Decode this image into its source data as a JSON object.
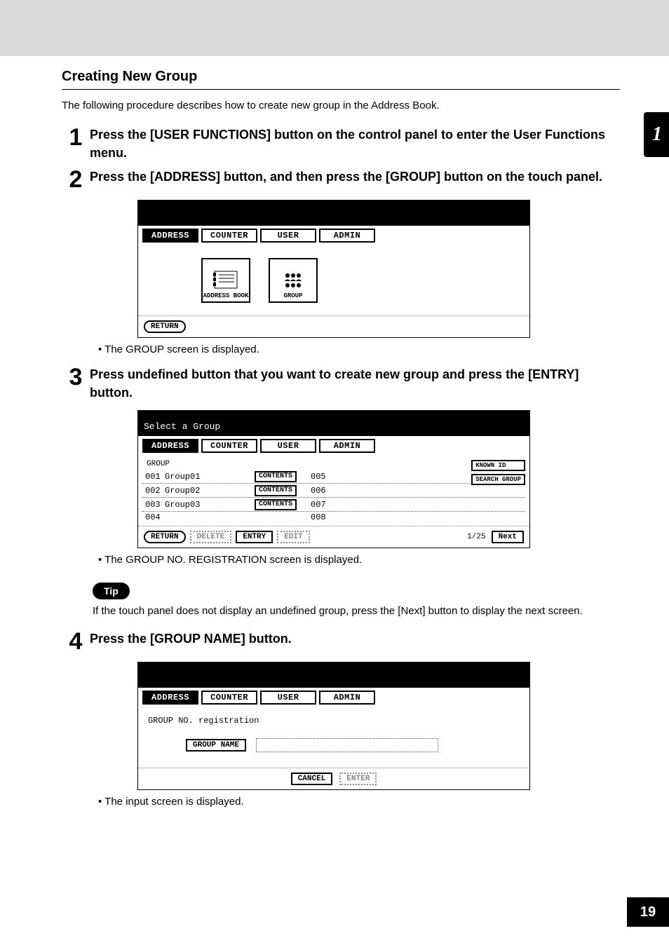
{
  "chapter_tab": "1",
  "page_number": "19",
  "section_title": "Creating New Group",
  "intro": "The following procedure describes how to create new group in the Address Book.",
  "steps": {
    "s1": {
      "num": "1",
      "text": "Press the [USER FUNCTIONS] button on the control panel to enter the User Functions menu."
    },
    "s2": {
      "num": "2",
      "text": "Press the [ADDRESS] button, and then press the [GROUP] button on the touch panel.",
      "note": "The GROUP screen is displayed."
    },
    "s3": {
      "num": "3",
      "text": "Press undefined button that you want to create new group and press the [ENTRY] button.",
      "note": "The GROUP NO. REGISTRATION screen is displayed."
    },
    "s4": {
      "num": "4",
      "text": "Press the [GROUP NAME] button.",
      "note": "The input screen is displayed."
    }
  },
  "tip": {
    "label": "Tip",
    "text": "If the touch panel does not display an undefined group, press the [Next] button to display the next screen."
  },
  "panel_common": {
    "tabs": {
      "address": "ADDRESS",
      "counter": "COUNTER",
      "user": "USER",
      "admin": "ADMIN"
    },
    "return": "RETURN"
  },
  "panel1": {
    "icons": {
      "address_book": "ADDRESS BOOK",
      "group": "GROUP"
    }
  },
  "panel2": {
    "title": "Select a Group",
    "header": "GROUP",
    "contents_label": "CONTENTS",
    "rows": [
      {
        "id": "001",
        "name": "Group01",
        "rid": "005"
      },
      {
        "id": "002",
        "name": "Group02",
        "rid": "006"
      },
      {
        "id": "003",
        "name": "Group03",
        "rid": "007"
      },
      {
        "id": "004",
        "name": "",
        "rid": "008"
      }
    ],
    "side": {
      "known_id": "KNOWN ID",
      "search_group": "SEARCH GROUP"
    },
    "footer": {
      "return": "RETURN",
      "delete": "DELETE",
      "entry": "ENTRY",
      "edit": "EDIT",
      "page": "1/25",
      "next": "Next"
    }
  },
  "panel3": {
    "subtitle": "GROUP NO. registration",
    "group_name_btn": "GROUP NAME",
    "cancel": "CANCEL",
    "enter": "ENTER"
  }
}
